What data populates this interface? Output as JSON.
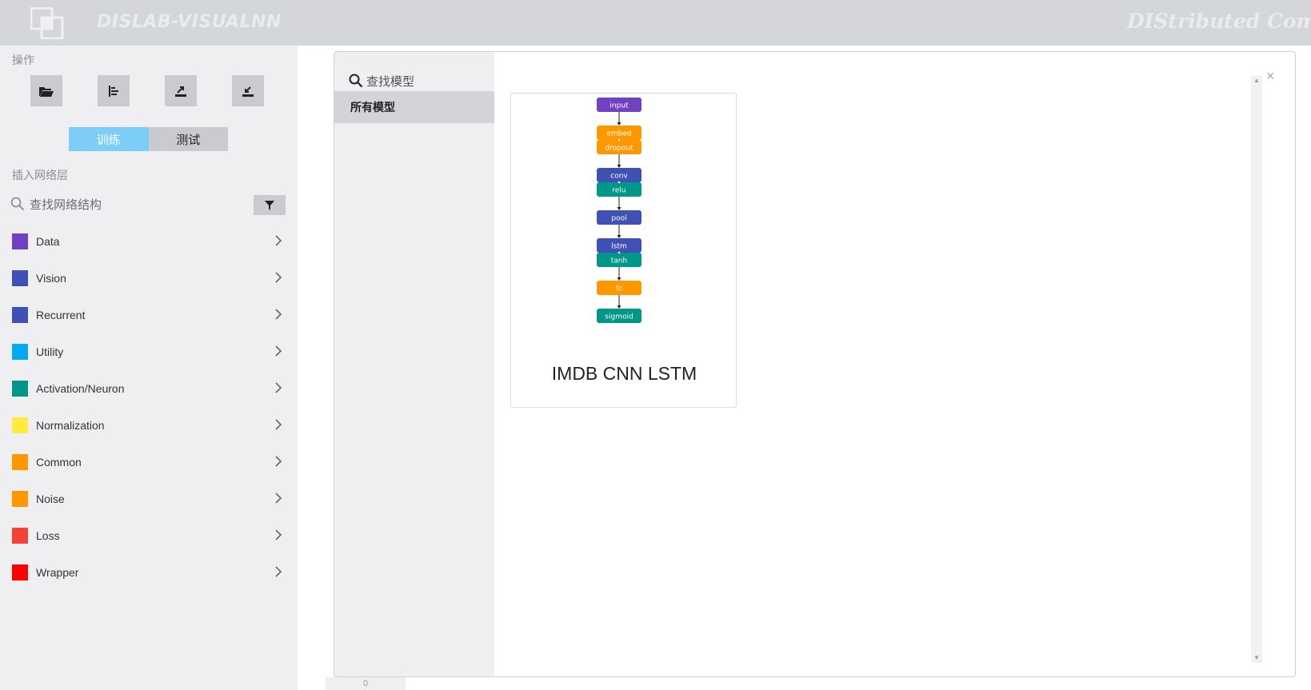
{
  "header": {
    "brand": "DISLAB-VISUALNN",
    "tagline": "DIStributed Compu",
    "logo_icon": "logo-squares-icon"
  },
  "sidebar": {
    "ops_label": "操作",
    "toolbar": [
      {
        "icon": "folder-open-icon"
      },
      {
        "icon": "align-left-icon"
      },
      {
        "icon": "export-icon"
      },
      {
        "icon": "import-icon"
      }
    ],
    "mode": {
      "train": "训练",
      "test": "测试",
      "active": "train"
    },
    "insert_label": "插入网络层",
    "search_placeholder": "查找网络结构",
    "filter_icon": "filter-icon",
    "layers": [
      {
        "label": "Data",
        "color": "#6f42c1"
      },
      {
        "label": "Vision",
        "color": "#3f51b5"
      },
      {
        "label": "Recurrent",
        "color": "#3f51b5"
      },
      {
        "label": "Utility",
        "color": "#03a9f4"
      },
      {
        "label": "Activation/Neuron",
        "color": "#009688"
      },
      {
        "label": "Normalization",
        "color": "#ffeb3b"
      },
      {
        "label": "Common",
        "color": "#ff9800"
      },
      {
        "label": "Noise",
        "color": "#ff9800"
      },
      {
        "label": "Loss",
        "color": "#f44336"
      },
      {
        "label": "Wrapper",
        "color": "#ff0000"
      }
    ]
  },
  "dialog": {
    "search_label": "查找模型",
    "categories": [
      "所有模型"
    ],
    "close_label": "×",
    "scroll_up": "▲",
    "scroll_down": "▼",
    "models": [
      {
        "title": "IMDB CNN LSTM",
        "nodes": [
          {
            "parts": [
              "input"
            ],
            "colors": [
              "#6f42c1"
            ]
          },
          {
            "parts": [
              "embed",
              "dropout"
            ],
            "colors": [
              "#ff9800",
              "#ff9800"
            ]
          },
          {
            "parts": [
              "conv",
              "relu"
            ],
            "colors": [
              "#3f51b5",
              "#009688"
            ]
          },
          {
            "parts": [
              "pool"
            ],
            "colors": [
              "#3f51b5"
            ]
          },
          {
            "parts": [
              "lstm",
              "tanh"
            ],
            "colors": [
              "#3f51b5",
              "#009688"
            ]
          },
          {
            "parts": [
              "fc"
            ],
            "colors": [
              "#ff9800"
            ]
          },
          {
            "parts": [
              "sigmoid"
            ],
            "colors": [
              "#009688"
            ]
          }
        ]
      }
    ]
  },
  "bottom_tab": "0"
}
